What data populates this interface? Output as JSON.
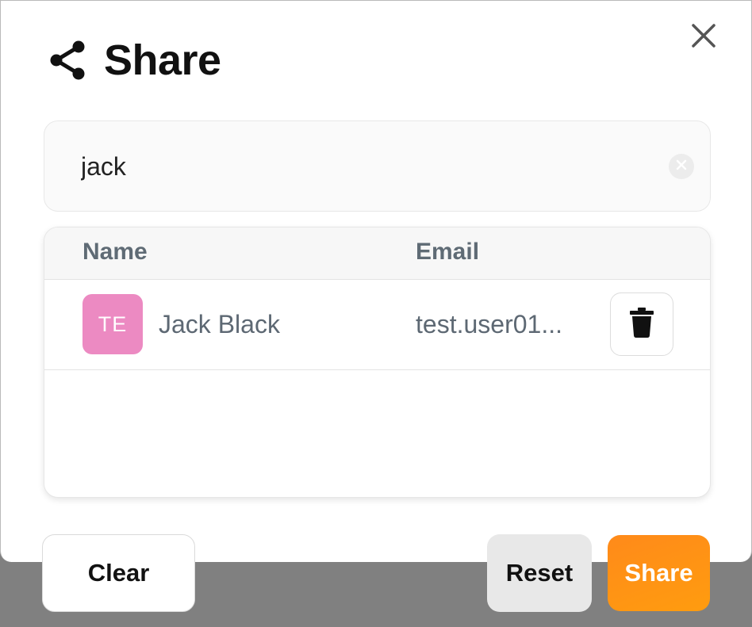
{
  "dialog": {
    "title": "Share",
    "icons": {
      "title": "share-icon",
      "close": "close-icon"
    }
  },
  "search": {
    "value": "jack",
    "clear_icon": "clear-circle-icon"
  },
  "table": {
    "columns": [
      "Name",
      "Email"
    ],
    "rows": [
      {
        "initials": "TE",
        "name": "Jack Black",
        "email": "test.user01...",
        "avatar_color": "#ec8ac2",
        "action_icon": "trash-icon"
      }
    ]
  },
  "footer": {
    "clear_label": "Clear",
    "reset_label": "Reset",
    "share_label": "Share"
  },
  "colors": {
    "accent": "#ff8a1a",
    "overlay": "#808080"
  }
}
